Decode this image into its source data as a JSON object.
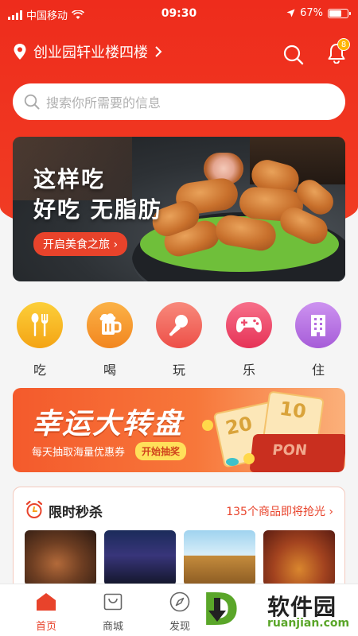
{
  "status": {
    "carrier": "中国移动",
    "time": "09:30",
    "battery": "67%",
    "battery_level": 0.67
  },
  "header": {
    "location": "创业园轩业楼四楼",
    "notification_count": "8"
  },
  "search": {
    "placeholder": "搜索你所需要的信息"
  },
  "banner": {
    "line1": "这样吃",
    "line2": "好吃 无脂肪",
    "cta": "开启美食之旅 ›"
  },
  "categories": [
    {
      "label": "吃",
      "icon": "fork-spoon-icon",
      "color": "#f7b21c"
    },
    {
      "label": "喝",
      "icon": "beer-icon",
      "color": "#f59a2a"
    },
    {
      "label": "玩",
      "icon": "microphone-icon",
      "color": "#f0605e"
    },
    {
      "label": "乐",
      "icon": "gamepad-icon",
      "color": "#ef4a6f"
    },
    {
      "label": "住",
      "icon": "building-icon",
      "color": "#b46ce0"
    }
  ],
  "promo": {
    "title": "幸运大转盘",
    "subtitle": "每天抽取海量优惠券",
    "button": "开始抽奖",
    "ticket_text": [
      "20",
      "10",
      "PON"
    ]
  },
  "flash_sale": {
    "title": "限时秒杀",
    "more": "135个商品即将抢光 ›"
  },
  "tabs": [
    {
      "label": "首页",
      "icon": "home-icon",
      "active": true
    },
    {
      "label": "商城",
      "icon": "mall-icon"
    },
    {
      "label": "发现",
      "icon": "compass-icon"
    }
  ],
  "watermark": {
    "text": "软件园",
    "url": "ruanjian.com",
    "logo_letter": "D"
  },
  "colors": {
    "accent": "#e8432b",
    "header": "#ee2c1c"
  }
}
